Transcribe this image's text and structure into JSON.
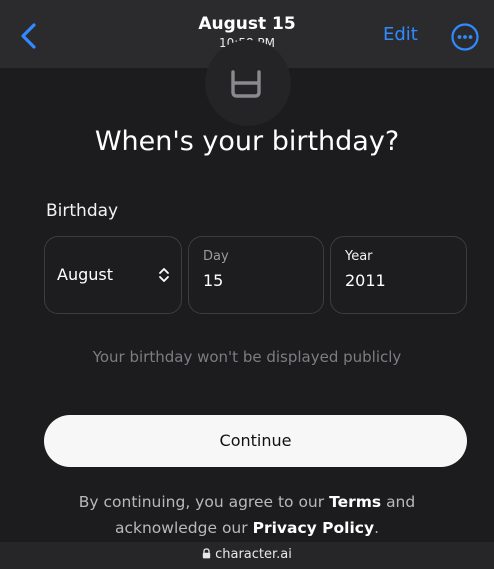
{
  "navbar": {
    "title": "August 15",
    "subtitle": "10:58 PM",
    "edit_label": "Edit",
    "back_icon": "chevron-left-icon",
    "more_icon": "ellipsis-circle-icon",
    "accent_color": "#2f8bff"
  },
  "main": {
    "logo_icon": "cup-icon",
    "heading": "When's your birthday?",
    "field_label": "Birthday",
    "month": {
      "value": "August",
      "icon": "chevron-up-down-icon"
    },
    "day": {
      "caption": "Day",
      "value": "15"
    },
    "year": {
      "caption": "Year",
      "value": "2011"
    },
    "privacy_note": "Your birthday won't be displayed publicly",
    "continue_label": "Continue",
    "terms": {
      "prefix": "By continuing, you agree to our",
      "terms_link": "Terms",
      "middle": "and acknowledge our",
      "privacy_link": "Privacy Policy",
      "suffix": "."
    }
  },
  "address_bar": {
    "lock_icon": "lock-icon",
    "url": "character.ai"
  }
}
